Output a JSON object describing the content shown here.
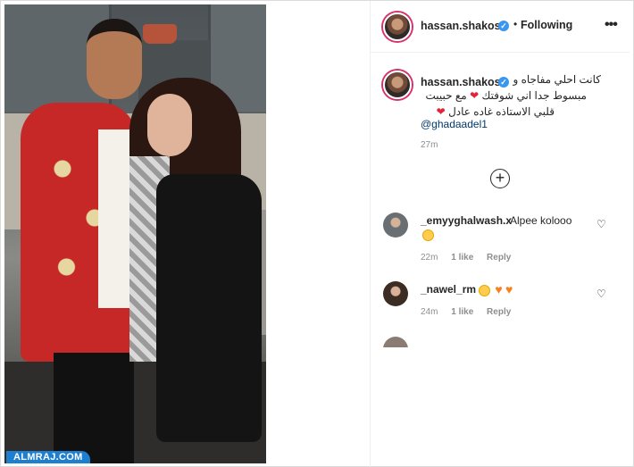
{
  "watermark": "ALMRAJ.COM",
  "post": {
    "username": "hassan.shakosh",
    "verified_mark": "✓",
    "separator": "•",
    "follow_status": "Following",
    "more_icon": "•••",
    "caption": {
      "username": "hassan.shakosh",
      "line1": "كانت احلي مفاجاه و",
      "line2": "مبسوط جدا اني شوفتك",
      "line2_after": "مع حبيبت",
      "line3": "قلبي الاستاذه غاده عادل",
      "heart": "❤",
      "mention": "@ghadaadel1",
      "time": "27m"
    },
    "load_more_icon": "+"
  },
  "comments": [
    {
      "username": "_emyyghalwash.x",
      "text": "Alpee kolooo",
      "time": "22m",
      "likes": "1 like",
      "reply": "Reply",
      "like_icon": "♡"
    },
    {
      "username": "_nawel_rm",
      "text": "",
      "time": "24m",
      "likes": "1 like",
      "reply": "Reply",
      "like_icon": "♡",
      "emoji_hearts": [
        "♥",
        "♥"
      ]
    }
  ]
}
